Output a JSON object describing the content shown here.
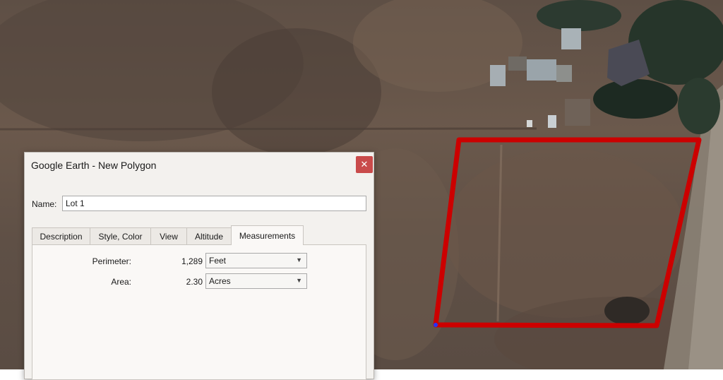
{
  "dialog": {
    "title": "Google Earth - New Polygon",
    "close_glyph": "✕",
    "name_label": "Name:",
    "name_value": "Lot 1",
    "tabs": [
      {
        "label": "Description"
      },
      {
        "label": "Style, Color"
      },
      {
        "label": "View"
      },
      {
        "label": "Altitude"
      },
      {
        "label": "Measurements",
        "active": true
      }
    ],
    "measurements": {
      "perimeter_label": "Perimeter:",
      "perimeter_value": "1,289",
      "perimeter_unit": "Feet",
      "area_label": "Area:",
      "area_value": "2.30",
      "area_unit": "Acres",
      "dropdown_glyph": "▼"
    }
  },
  "map": {
    "polygon_color": "#cc0000",
    "vertex_color": "#2233ff"
  }
}
